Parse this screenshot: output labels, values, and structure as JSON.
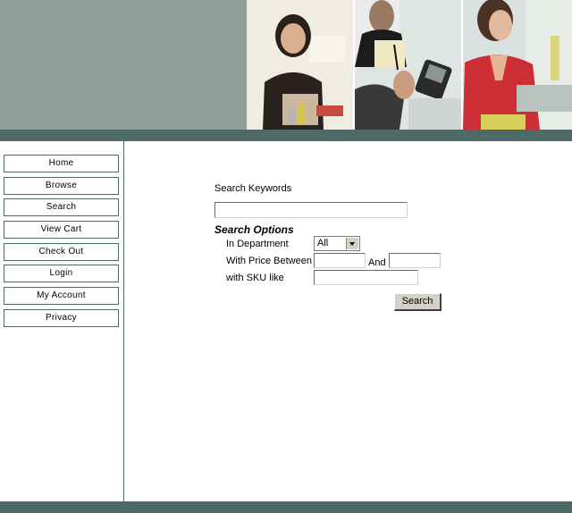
{
  "banner": {
    "photos": [
      "woman-smiling-photo",
      "man-with-pda-photo",
      "woman-at-laptop-photo"
    ]
  },
  "nav": {
    "items": [
      "Home",
      "Browse",
      "Search",
      "View Cart",
      "Check Out",
      "Login",
      "My Account",
      "Privacy"
    ]
  },
  "search": {
    "keywords_label": "Search Keywords",
    "keywords_value": "",
    "options_heading": "Search Options",
    "department_label": "In Department",
    "department_selected": "All",
    "price_label": "With Price Between",
    "price_min": "",
    "and_label": "And",
    "price_max": "",
    "sku_label": "with SKU like",
    "sku_value": "",
    "submit_label": "Search"
  },
  "colors": {
    "banner": "#8da09b",
    "band": "#4e6a67"
  }
}
